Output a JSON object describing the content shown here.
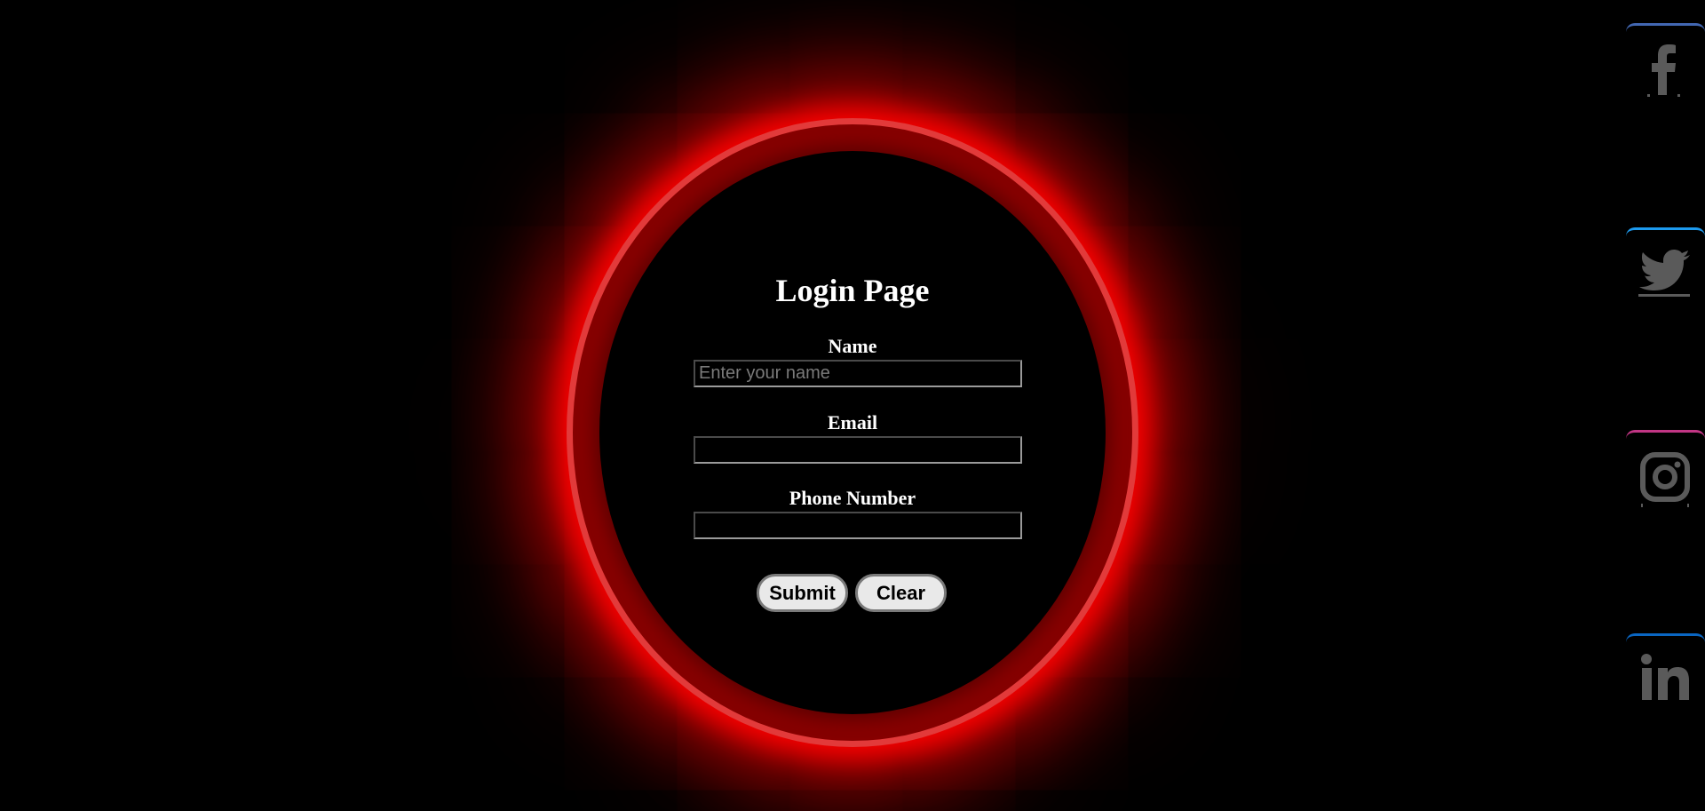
{
  "form": {
    "title": "Login Page",
    "name_label": "Name",
    "name_placeholder": "Enter your name",
    "name_value": "",
    "email_label": "Email",
    "email_value": "",
    "phone_label": "Phone Number",
    "phone_value": "",
    "submit_label": "Submit",
    "clear_label": "Clear"
  },
  "social": [
    {
      "name": "facebook",
      "icon": "facebook-icon",
      "accent": "#4267b2"
    },
    {
      "name": "twitter",
      "icon": "twitter-icon",
      "accent": "#1d9bf0"
    },
    {
      "name": "instagram",
      "icon": "instagram-icon",
      "accent": "#c13584"
    },
    {
      "name": "linkedin",
      "icon": "linkedin-icon",
      "accent": "#0a66c2"
    }
  ],
  "colors": {
    "background": "#000000",
    "ring_glow": "#ff0000",
    "ring_body": "#860000",
    "ring_border": "#e23a3a",
    "text": "#ffffff",
    "icon": "#5a5a5a"
  }
}
